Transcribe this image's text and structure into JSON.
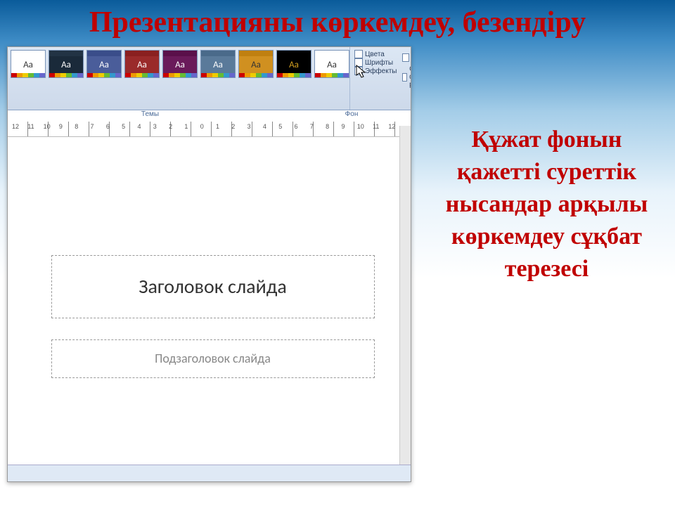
{
  "title": "Презентацияны көркемдеу, безендіру",
  "ribbon": {
    "side": {
      "row1": "Цвета",
      "row2": "Шрифты",
      "row3": "Эффекты",
      "col2a": "Стили фона",
      "col2b": "Скрыть фоновые рису"
    },
    "group1": "Темы",
    "group2": "Фон"
  },
  "themes": [
    {
      "bg": "#ffffff",
      "top": "#ffffff",
      "text": "Aa",
      "color": "#333"
    },
    {
      "bg": "#1a2a3a",
      "top": "#223344",
      "text": "Aa",
      "color": "#fff"
    },
    {
      "bg": "#4a5d9a",
      "top": "#3a4d8a",
      "text": "Aa",
      "color": "#fff"
    },
    {
      "bg": "#9a2a2a",
      "top": "#8a2020",
      "text": "Aa",
      "color": "#fff"
    },
    {
      "bg": "#6a1a5a",
      "top": "#5a104a",
      "text": "Aa",
      "color": "#fff"
    },
    {
      "bg": "#5a7a9a",
      "top": "#4a6a8a",
      "text": "Aa",
      "color": "#fff"
    },
    {
      "bg": "#d09020",
      "top": "#c08010",
      "text": "Aa",
      "color": "#333"
    },
    {
      "bg": "#000000",
      "top": "#000000",
      "text": "Aa",
      "color": "#d4a020"
    },
    {
      "bg": "#ffffff",
      "top": "#ffffff",
      "text": "Aa",
      "color": "#333"
    }
  ],
  "swatch_palette": [
    "#c00",
    "#e90",
    "#ec0",
    "#6b3",
    "#39c",
    "#66c"
  ],
  "ruler_marks": [
    "12",
    "11",
    "10",
    "9",
    "8",
    "7",
    "6",
    "5",
    "4",
    "3",
    "2",
    "1",
    "0",
    "1",
    "2",
    "3",
    "4",
    "5",
    "6",
    "7",
    "8",
    "9",
    "10",
    "11",
    "12"
  ],
  "slide": {
    "title_placeholder": "Заголовок слайда",
    "subtitle_placeholder": "Подзаголовок слайда"
  },
  "statusbar": "",
  "right_text": "Құжат фонын қажетті суреттік нысандар арқылы көркемдеу сұқбат терезесі"
}
